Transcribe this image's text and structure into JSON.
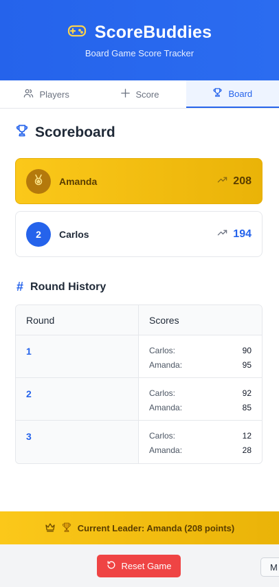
{
  "app": {
    "title": "ScoreBuddies",
    "subtitle": "Board Game Score Tracker",
    "logo_icon": "gamepad-icon"
  },
  "tabs": [
    {
      "label": "Players",
      "icon": "users-icon",
      "active": false
    },
    {
      "label": "Score",
      "icon": "plus-icon",
      "active": false
    },
    {
      "label": "Board",
      "icon": "trophy-icon",
      "active": true
    }
  ],
  "scoreboard": {
    "title": "Scoreboard",
    "players": [
      {
        "rank_badge": "medal",
        "name": "Amanda",
        "score": "208",
        "leader": true
      },
      {
        "rank_badge": "2",
        "name": "Carlos",
        "score": "194",
        "leader": false
      }
    ]
  },
  "history": {
    "title": "Round History",
    "headers": [
      "Round",
      "Scores"
    ],
    "rounds": [
      {
        "round": "1",
        "scores": [
          {
            "player": "Carlos:",
            "score": "90"
          },
          {
            "player": "Amanda:",
            "score": "95"
          }
        ]
      },
      {
        "round": "2",
        "scores": [
          {
            "player": "Carlos:",
            "score": "92"
          },
          {
            "player": "Amanda:",
            "score": "85"
          }
        ]
      },
      {
        "round": "3",
        "scores": [
          {
            "player": "Carlos:",
            "score": "12"
          },
          {
            "player": "Amanda:",
            "score": "28"
          }
        ]
      }
    ]
  },
  "leader_banner": {
    "text": "Current Leader: Amanda (208 points)"
  },
  "footer": {
    "reset_label": "Reset Game",
    "side_button_label": "M"
  },
  "colors": {
    "primary": "#2563eb",
    "gold": "#eab308",
    "danger": "#ef4444"
  }
}
